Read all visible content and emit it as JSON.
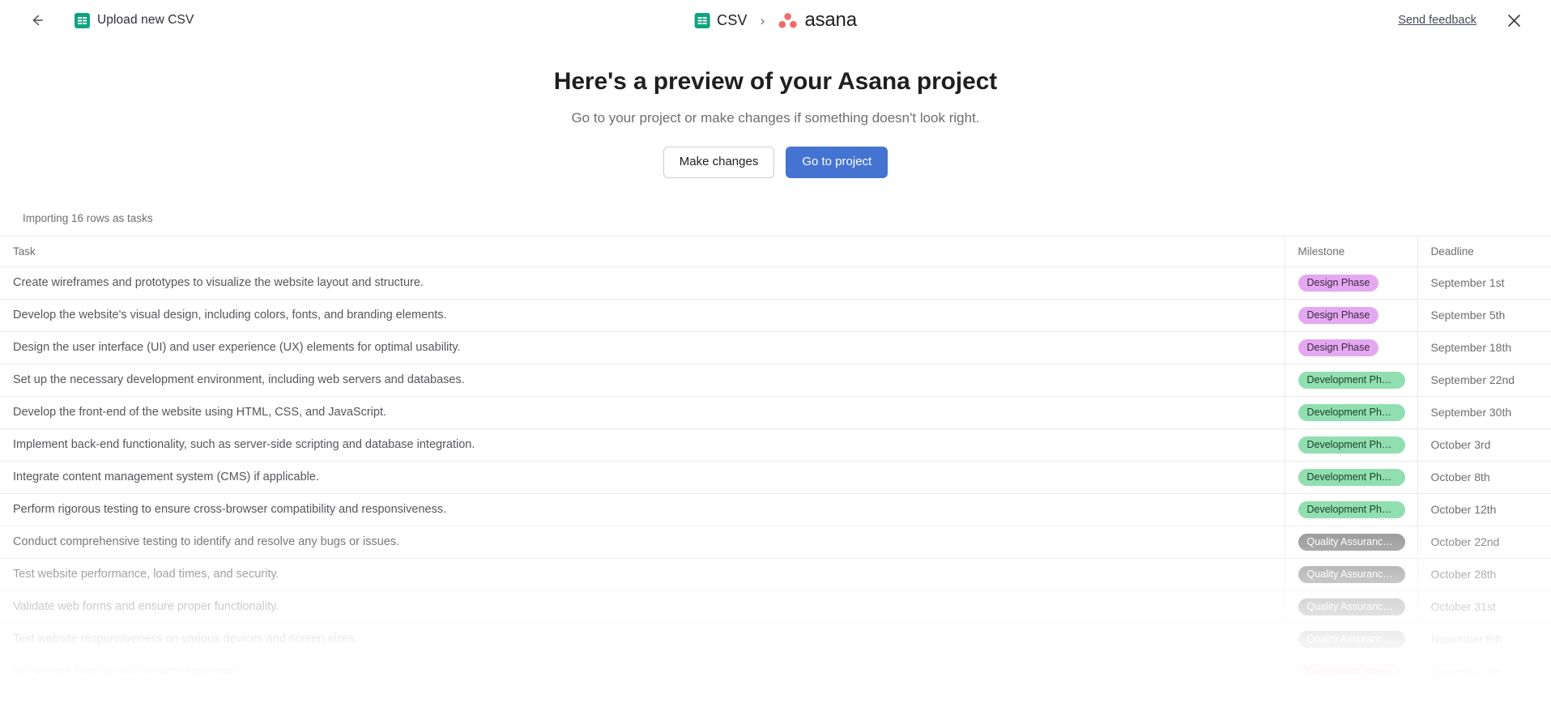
{
  "topbar": {
    "back_icon": "arrow-left-icon",
    "sheets_icon": "google-sheets-icon",
    "upload_label": "Upload new CSV",
    "breadcrumb": {
      "source_label": "CSV",
      "separator": "›",
      "target_label": "asana"
    },
    "send_feedback_label": "Send feedback",
    "close_icon": "close-icon"
  },
  "hero": {
    "title": "Here's a preview of your Asana project",
    "subtitle": "Go to your project or make changes if something doesn't look right.",
    "secondary_button": "Make changes",
    "primary_button": "Go to project"
  },
  "table": {
    "importing_note": "Importing 16 rows as tasks",
    "columns": [
      "Task",
      "Milestone",
      "Deadline"
    ],
    "rows": [
      {
        "task": "Create wireframes and prototypes to visualize the website layout and structure.",
        "milestone": "Design Phase",
        "milestone_color": "purple",
        "deadline": "September 1st"
      },
      {
        "task": "Develop the website's visual design, including colors, fonts, and branding elements.",
        "milestone": "Design Phase",
        "milestone_color": "purple",
        "deadline": "September 5th"
      },
      {
        "task": "Design the user interface (UI) and user experience (UX) elements for optimal usability.",
        "milestone": "Design Phase",
        "milestone_color": "purple",
        "deadline": "September 18th"
      },
      {
        "task": "Set up the necessary development environment, including web servers and databases.",
        "milestone": "Development Phase",
        "milestone_color": "green",
        "deadline": "September 22nd"
      },
      {
        "task": "Develop the front-end of the website using HTML, CSS, and JavaScript.",
        "milestone": "Development Phase",
        "milestone_color": "green",
        "deadline": "September 30th"
      },
      {
        "task": "Implement back-end functionality, such as server-side scripting and database integration.",
        "milestone": "Development Phase",
        "milestone_color": "green",
        "deadline": "October 3rd"
      },
      {
        "task": "Integrate content management system (CMS) if applicable.",
        "milestone": "Development Phase",
        "milestone_color": "green",
        "deadline": "October 8th"
      },
      {
        "task": "Perform rigorous testing to ensure cross-browser compatibility and responsiveness.",
        "milestone": "Development Phase",
        "milestone_color": "green",
        "deadline": "October 12th"
      },
      {
        "task": "Conduct comprehensive testing to identify and resolve any bugs or issues.",
        "milestone": "Quality Assurance P...",
        "milestone_color": "grey",
        "deadline": "October 22nd"
      },
      {
        "task": "Test website performance, load times, and security.",
        "milestone": "Quality Assurance P...",
        "milestone_color": "grey",
        "deadline": "October 28th"
      },
      {
        "task": "Validate web forms and ensure proper functionality.",
        "milestone": "Quality Assurance P...",
        "milestone_color": "grey",
        "deadline": "October 31st"
      },
      {
        "task": "Test website responsiveness on various devices and screen sizes.",
        "milestone": "Quality Assurance P...",
        "milestone_color": "grey",
        "deadline": "November 5th"
      },
      {
        "task": "Set up web hosting and domain registration.",
        "milestone": "Deployment Phase",
        "milestone_color": "pink",
        "deadline": "November 8th"
      }
    ]
  },
  "colors": {
    "primary_button": "#4573d2",
    "asana_logo": "#f06a6a",
    "sheets_icon": "#0fa47f",
    "pill_purple": "#e4a8f0",
    "pill_green": "#91dfb0",
    "pill_grey": "#8d8d8d",
    "pill_pink": "#f8b5ba",
    "row_divider": "#edeae9"
  }
}
